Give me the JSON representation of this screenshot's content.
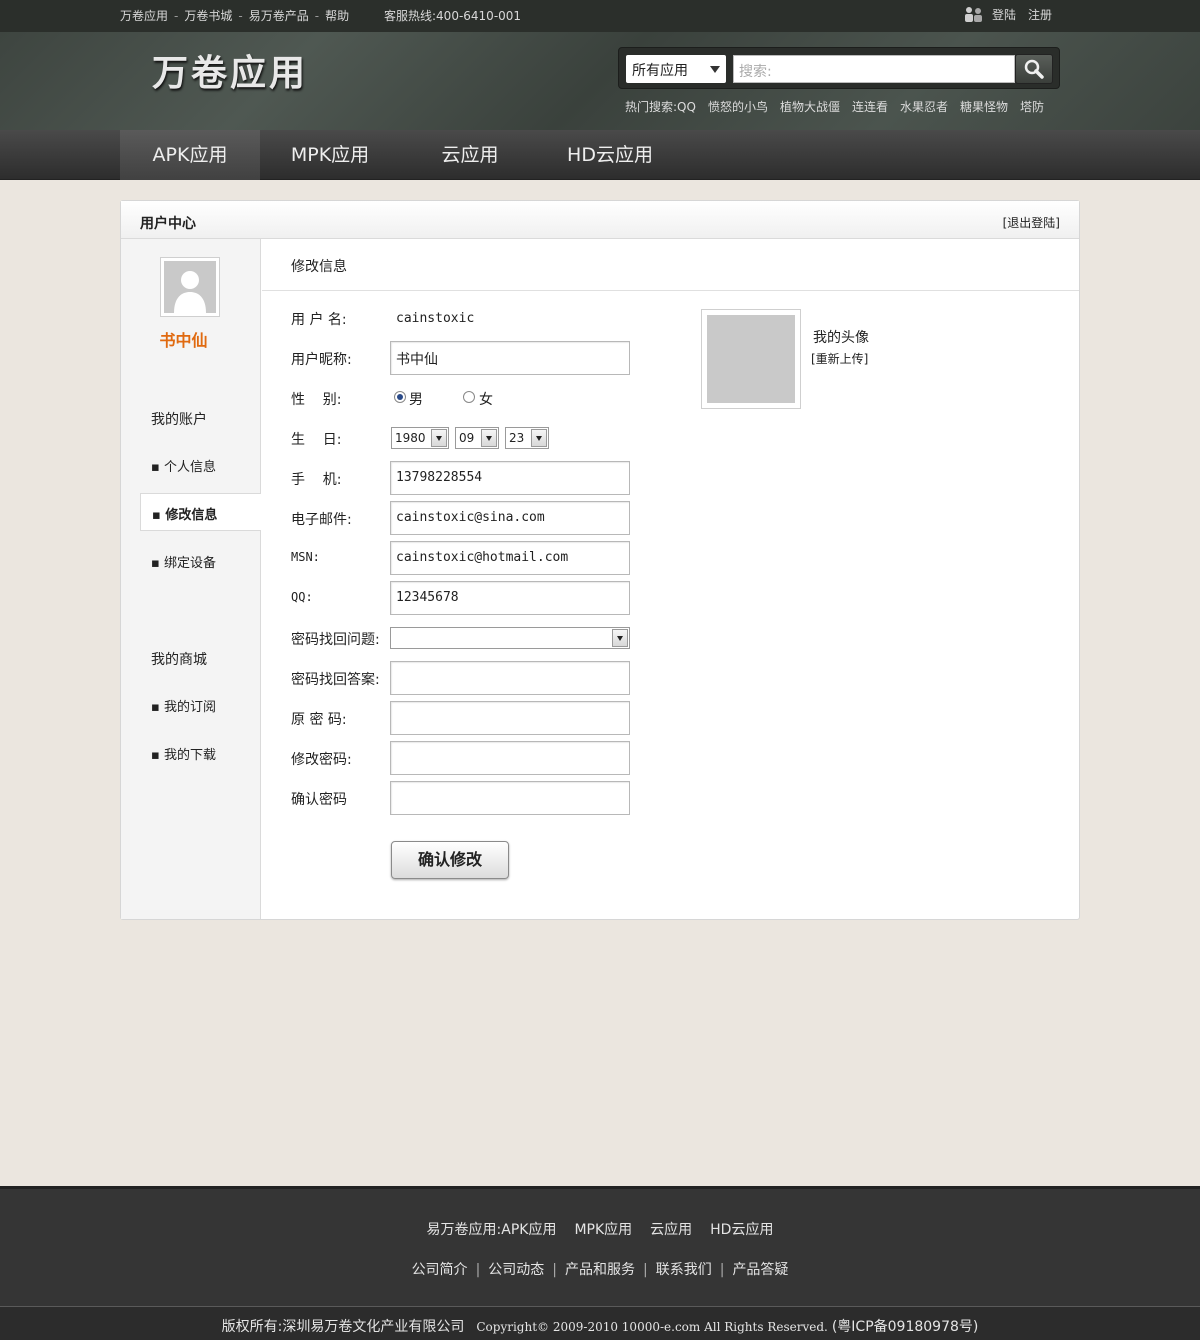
{
  "topbar": {
    "links": [
      "万卷应用",
      "万卷书城",
      "易万卷产品",
      "帮助"
    ],
    "hotline": "客服热线:400-6410-001",
    "login": "登陆",
    "register": "注册"
  },
  "header": {
    "logo": "万卷应用",
    "search_scope": "所有应用",
    "search_placeholder": "搜索:",
    "hot_label": "热门搜索:",
    "hot_items": [
      "QQ",
      "愤怒的小鸟",
      "植物大战僵",
      "连连看",
      "水果忍者",
      "糖果怪物",
      "塔防"
    ]
  },
  "nav": {
    "items": [
      "APK应用",
      "MPK应用",
      "云应用",
      "HD云应用"
    ],
    "active_index": 0
  },
  "panel": {
    "title": "用户中心",
    "logout": "[退出登陆]"
  },
  "sidebar": {
    "username": "书中仙",
    "group1": "我的账户",
    "items1": [
      "▪ 个人信息",
      "▪ 修改信息",
      "▪ 绑定设备"
    ],
    "active_item": "▪ 修改信息",
    "group2": "我的商城",
    "items2": [
      "▪ 我的订阅",
      "▪ 我的下载"
    ]
  },
  "form": {
    "section_title": "修改信息",
    "username_label": "用 户 名:",
    "username_value": "cainstoxic",
    "nickname_label": "用户昵称:",
    "nickname_value": "书中仙",
    "gender_label": "性    别:",
    "gender_male": "男",
    "gender_female": "女",
    "gender_selected": "男",
    "birthday_label": "生    日:",
    "birth_year": "1980",
    "birth_month": "09",
    "birth_day": "23",
    "phone_label": "手    机:",
    "phone_value": "13798228554",
    "email_label": "电子邮件:",
    "email_value": "cainstoxic@sina.com",
    "msn_label": "MSN:",
    "msn_value": "cainstoxic@hotmail.com",
    "qq_label": "QQ:",
    "qq_value": "12345678",
    "question_label": "密码找回问题:",
    "question_value": "",
    "answer_label": "密码找回答案:",
    "answer_value": "",
    "old_pwd_label": "原 密 码:",
    "new_pwd_label": "修改密码:",
    "confirm_pwd_label": "确认密码",
    "submit_label": "确认修改",
    "avatar_label": "我的头像",
    "reupload_label": "[重新上传]"
  },
  "footer": {
    "product_line": [
      "易万卷应用:APK应用",
      "MPK应用",
      "云应用",
      "HD云应用"
    ],
    "links": [
      "公司简介",
      "公司动态",
      "产品和服务",
      "联系我们",
      "产品答疑"
    ],
    "copyright_cn": "版权所有:深圳易万卷文化产业有限公司",
    "copyright_en": "Copyright© 2009-2010 10000-e.com All Rights Reserved.",
    "icp": "(粤ICP备09180978号)"
  },
  "colors": {
    "accent_orange": "#e06a10",
    "header_bg": "#434b45",
    "nav_bg": "#3a3a3a",
    "page_bg": "#ebe6df"
  }
}
